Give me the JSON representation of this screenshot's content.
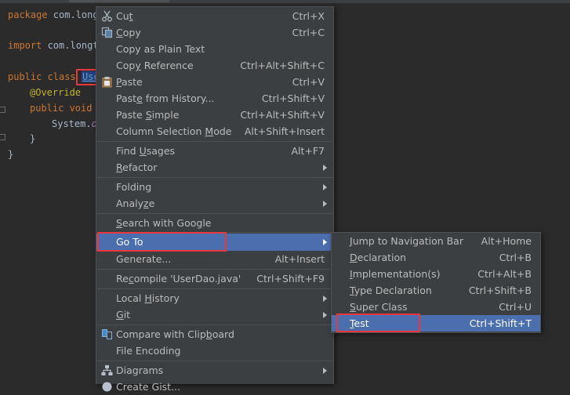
{
  "editor": {
    "lines": {
      "package_kw": "package",
      "package_rest": " com.longt",
      "import_kw": "import",
      "import_rest": " com.longt",
      "class_kw": "public class",
      "class_name": "Use",
      "annotation": "@Override",
      "method_kw": "public void",
      "system": "System.",
      "system_field": "o",
      "close1": "}",
      "close2": "}"
    }
  },
  "context_menu": {
    "cut": {
      "label": "Cut",
      "mnemonic": "t",
      "shortcut": "Ctrl+X",
      "icon": "scissors-icon"
    },
    "copy": {
      "label": "Copy",
      "mnemonic": "C",
      "shortcut": "Ctrl+C",
      "icon": "copy-icon"
    },
    "copy_plain": {
      "label": "Copy as Plain Text"
    },
    "copy_ref": {
      "label": "Copy Reference",
      "mnemonic": "y",
      "shortcut": "Ctrl+Alt+Shift+C"
    },
    "paste": {
      "label": "Paste",
      "mnemonic": "P",
      "shortcut": "Ctrl+V",
      "icon": "clipboard-icon"
    },
    "paste_history": {
      "label": "Paste from History...",
      "mnemonic": "e",
      "shortcut": "Ctrl+Shift+V"
    },
    "paste_simple": {
      "label": "Paste Simple",
      "mnemonic": "S",
      "shortcut": "Ctrl+Alt+Shift+V"
    },
    "column_mode": {
      "label": "Column Selection Mode",
      "mnemonic": "M",
      "shortcut": "Alt+Shift+Insert"
    },
    "find_usages": {
      "label": "Find Usages",
      "mnemonic": "U",
      "shortcut": "Alt+F7"
    },
    "refactor": {
      "label": "Refactor",
      "mnemonic": "R"
    },
    "folding": {
      "label": "Folding"
    },
    "analyze": {
      "label": "Analyze",
      "mnemonic": "z"
    },
    "search_google": {
      "label": "Search with Google",
      "mnemonic": "S"
    },
    "goto": {
      "label": "Go To"
    },
    "generate": {
      "label": "Generate...",
      "shortcut": "Alt+Insert"
    },
    "recompile": {
      "label": "Recompile 'UserDao.java'",
      "mnemonic": "c",
      "shortcut": "Ctrl+Shift+F9"
    },
    "local_history": {
      "label": "Local History",
      "mnemonic": "H"
    },
    "git": {
      "label": "Git",
      "mnemonic": "G"
    },
    "compare_clipboard": {
      "label": "Compare with Clipboard",
      "mnemonic": "b",
      "icon": "compare-icon"
    },
    "file_encoding": {
      "label": "File Encoding"
    },
    "diagrams": {
      "label": "Diagrams",
      "icon": "diagram-icon"
    },
    "create_gist": {
      "label": "Create Gist...",
      "icon": "github-icon"
    }
  },
  "goto_submenu": {
    "nav_bar": {
      "label": "Jump to Navigation Bar",
      "mnemonic": "J",
      "shortcut": "Alt+Home"
    },
    "declaration": {
      "label": "Declaration",
      "mnemonic": "D",
      "shortcut": "Ctrl+B"
    },
    "implementation": {
      "label": "Implementation(s)",
      "mnemonic": "I",
      "shortcut": "Ctrl+Alt+B"
    },
    "type_decl": {
      "label": "Type Declaration",
      "mnemonic": "T",
      "shortcut": "Ctrl+Shift+B"
    },
    "super_class": {
      "label": "Super Class",
      "mnemonic": "S",
      "shortcut": "Ctrl+U"
    },
    "test": {
      "label": "Test",
      "mnemonic": "T",
      "shortcut": "Ctrl+Shift+T"
    }
  },
  "colors": {
    "menu_bg": "#3c3f41",
    "selection": "#4b6eaf",
    "highlight_box": "#e8373d",
    "editor_bg": "#2b2b2b"
  }
}
